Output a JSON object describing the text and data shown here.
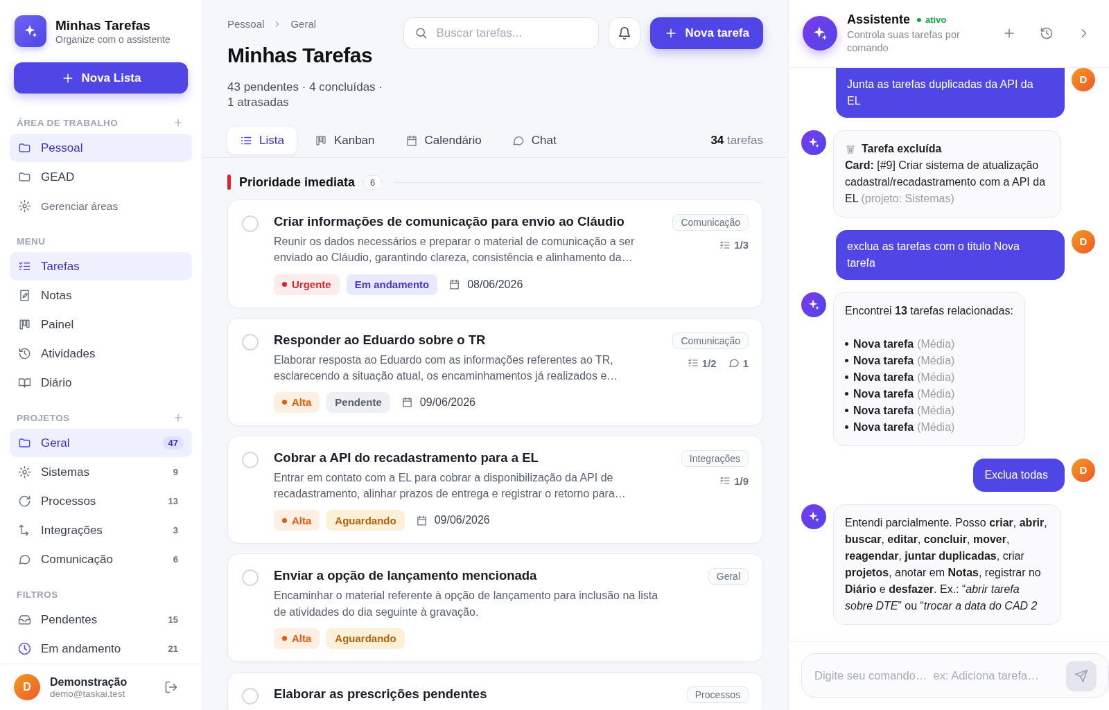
{
  "app": {
    "title": "Minhas Tarefas",
    "subtitle": "Organize com o assistente"
  },
  "sidebar": {
    "new_list": "Nova Lista",
    "sections": [
      {
        "title": "ÁREA DE TRABALHO",
        "addable": true,
        "items": [
          {
            "label": "Pessoal",
            "selected": true,
            "kind": "link"
          },
          {
            "label": "GEAD",
            "selected": false,
            "kind": "link"
          },
          {
            "label": "Gerenciar áreas",
            "selected": false,
            "kind": "action"
          }
        ]
      },
      {
        "title": "MENU",
        "addable": false,
        "items": [
          {
            "label": "Tarefas",
            "selected": true
          },
          {
            "label": "Notas",
            "selected": false
          },
          {
            "label": "Painel",
            "selected": false
          },
          {
            "label": "Atividades",
            "selected": false
          },
          {
            "label": "Diário",
            "selected": false
          }
        ]
      },
      {
        "title": "PROJETOS",
        "addable": true,
        "items": [
          {
            "label": "Geral",
            "selected": true,
            "count": "47"
          },
          {
            "label": "Sistemas",
            "selected": false,
            "count": "9"
          },
          {
            "label": "Processos",
            "selected": false,
            "count": "13"
          },
          {
            "label": "Integrações",
            "selected": false,
            "count": "3"
          },
          {
            "label": "Comunicação",
            "selected": false,
            "count": "6"
          }
        ]
      },
      {
        "title": "FILTROS",
        "addable": false,
        "items": [
          {
            "label": "Pendentes",
            "selected": false,
            "count": "15"
          },
          {
            "label": "Em andamento",
            "selected": false,
            "count": "21"
          }
        ]
      }
    ],
    "user": {
      "initial": "D",
      "name": "Demonstração",
      "email": "demo@taskai.test"
    }
  },
  "main": {
    "breadcrumb": [
      "Pessoal",
      "Geral"
    ],
    "title": "Minhas Tarefas",
    "stats": "43 pendentes · 4 concluídas · 1 atrasadas",
    "search": {
      "placeholder": "Buscar tarefas..."
    },
    "new_task": "Nova tarefa",
    "tabs": [
      {
        "label": "Lista",
        "selected": true
      },
      {
        "label": "Kanban",
        "selected": false
      },
      {
        "label": "Calendário",
        "selected": false
      },
      {
        "label": "Chat",
        "selected": false
      }
    ],
    "task_count": "**34** tarefas",
    "groups": [
      {
        "title": "Prioridade imediata",
        "count": "6",
        "tasks": [
          {
            "title": "Criar informações de comunicação para envio ao Cláudio",
            "description": "Reunir os dados necessários e preparar o material de comunicação a ser enviado ao Cláudio, garantindo clareza, consistência e alinhamento da…",
            "tag": "Comunicação",
            "done": false,
            "checklist": "1/3",
            "priority": {
              "label": "Urgente",
              "kind": "urgent"
            },
            "status": {
              "label": "Em andamento",
              "kind": "progress"
            },
            "date": "08/06/2026"
          },
          {
            "title": "Responder ao Eduardo sobre o TR",
            "description": "Elaborar resposta ao Eduardo com as informações referentes ao TR, esclarecendo a situação atual, os encaminhamentos já realizados e…",
            "tag": "Comunicação",
            "done": false,
            "checklist": "1/2",
            "comments": "1",
            "priority": {
              "label": "Alta",
              "kind": "high"
            },
            "status": {
              "label": "Pendente",
              "kind": "pending"
            },
            "date": "09/06/2026"
          },
          {
            "title": "Cobrar a API do recadastramento para a EL",
            "description": "Entrar em contato com a EL para cobrar a disponibilização da API de recadastramento, alinhar prazos de entrega e registrar o retorno para…",
            "tag": "Integrações",
            "done": false,
            "checklist": "1/9",
            "priority": {
              "label": "Alta",
              "kind": "high"
            },
            "status": {
              "label": "Aguardando",
              "kind": "waiting"
            },
            "date": "09/06/2026"
          },
          {
            "title": "Enviar a opção de lançamento mencionada",
            "description": "Encaminhar o material referente à opção de lançamento para inclusão na lista de atividades do dia seguinte à gravação.",
            "tag": "Geral",
            "done": false,
            "priority": {
              "label": "Alta",
              "kind": "high"
            },
            "status": {
              "label": "Aguardando",
              "kind": "waiting"
            }
          },
          {
            "title": "Elaborar as prescrições pendentes",
            "tag": "Processos",
            "done": false
          }
        ]
      }
    ]
  },
  "assistant": {
    "title": "Assistente",
    "status": "ativo",
    "subtitle": "Controla suas tarefas por comando",
    "messages": [
      {
        "kind": "user",
        "text": "Junta as tarefas duplicadas da API da EL",
        "avatar": "D"
      },
      {
        "kind": "deleted",
        "title": "Tarefa excluída",
        "body": "**Card:** [#9] Criar sistema de atualização cadastral/recadastramento com a API da EL",
        "note": "(projeto: Sistemas)"
      },
      {
        "kind": "user",
        "text": "exclua as tarefas com o titulo Nova tarefa",
        "avatar": "D"
      },
      {
        "kind": "list",
        "intro": "Encontrei **13** tarefas relacionadas:",
        "items": [
          {
            "name": "Nova tarefa",
            "priority": "(Média)"
          },
          {
            "name": "Nova tarefa",
            "priority": "(Média)"
          },
          {
            "name": "Nova tarefa",
            "priority": "(Média)"
          },
          {
            "name": "Nova tarefa",
            "priority": "(Média)"
          },
          {
            "name": "Nova tarefa",
            "priority": "(Média)"
          },
          {
            "name": "Nova tarefa",
            "priority": "(Média)"
          }
        ]
      },
      {
        "kind": "user",
        "text": "Exclua todas",
        "avatar": "D"
      },
      {
        "kind": "text",
        "text": "Entendi parcialmente. Posso **criar**, **abrir**, **buscar**, **editar**, **concluir**, **mover**, **reagendar**, **juntar duplicadas**, criar **projetos**, anotar em **Notas**, registrar no **Diário** e **desfazer**. Ex.: “*abrir tarefa sobre DTE*” ou “*trocar a data do CAD 2*"
      }
    ],
    "input": {
      "placeholder": "Digite seu comando…  ex: Adiciona tarefa…"
    }
  }
}
